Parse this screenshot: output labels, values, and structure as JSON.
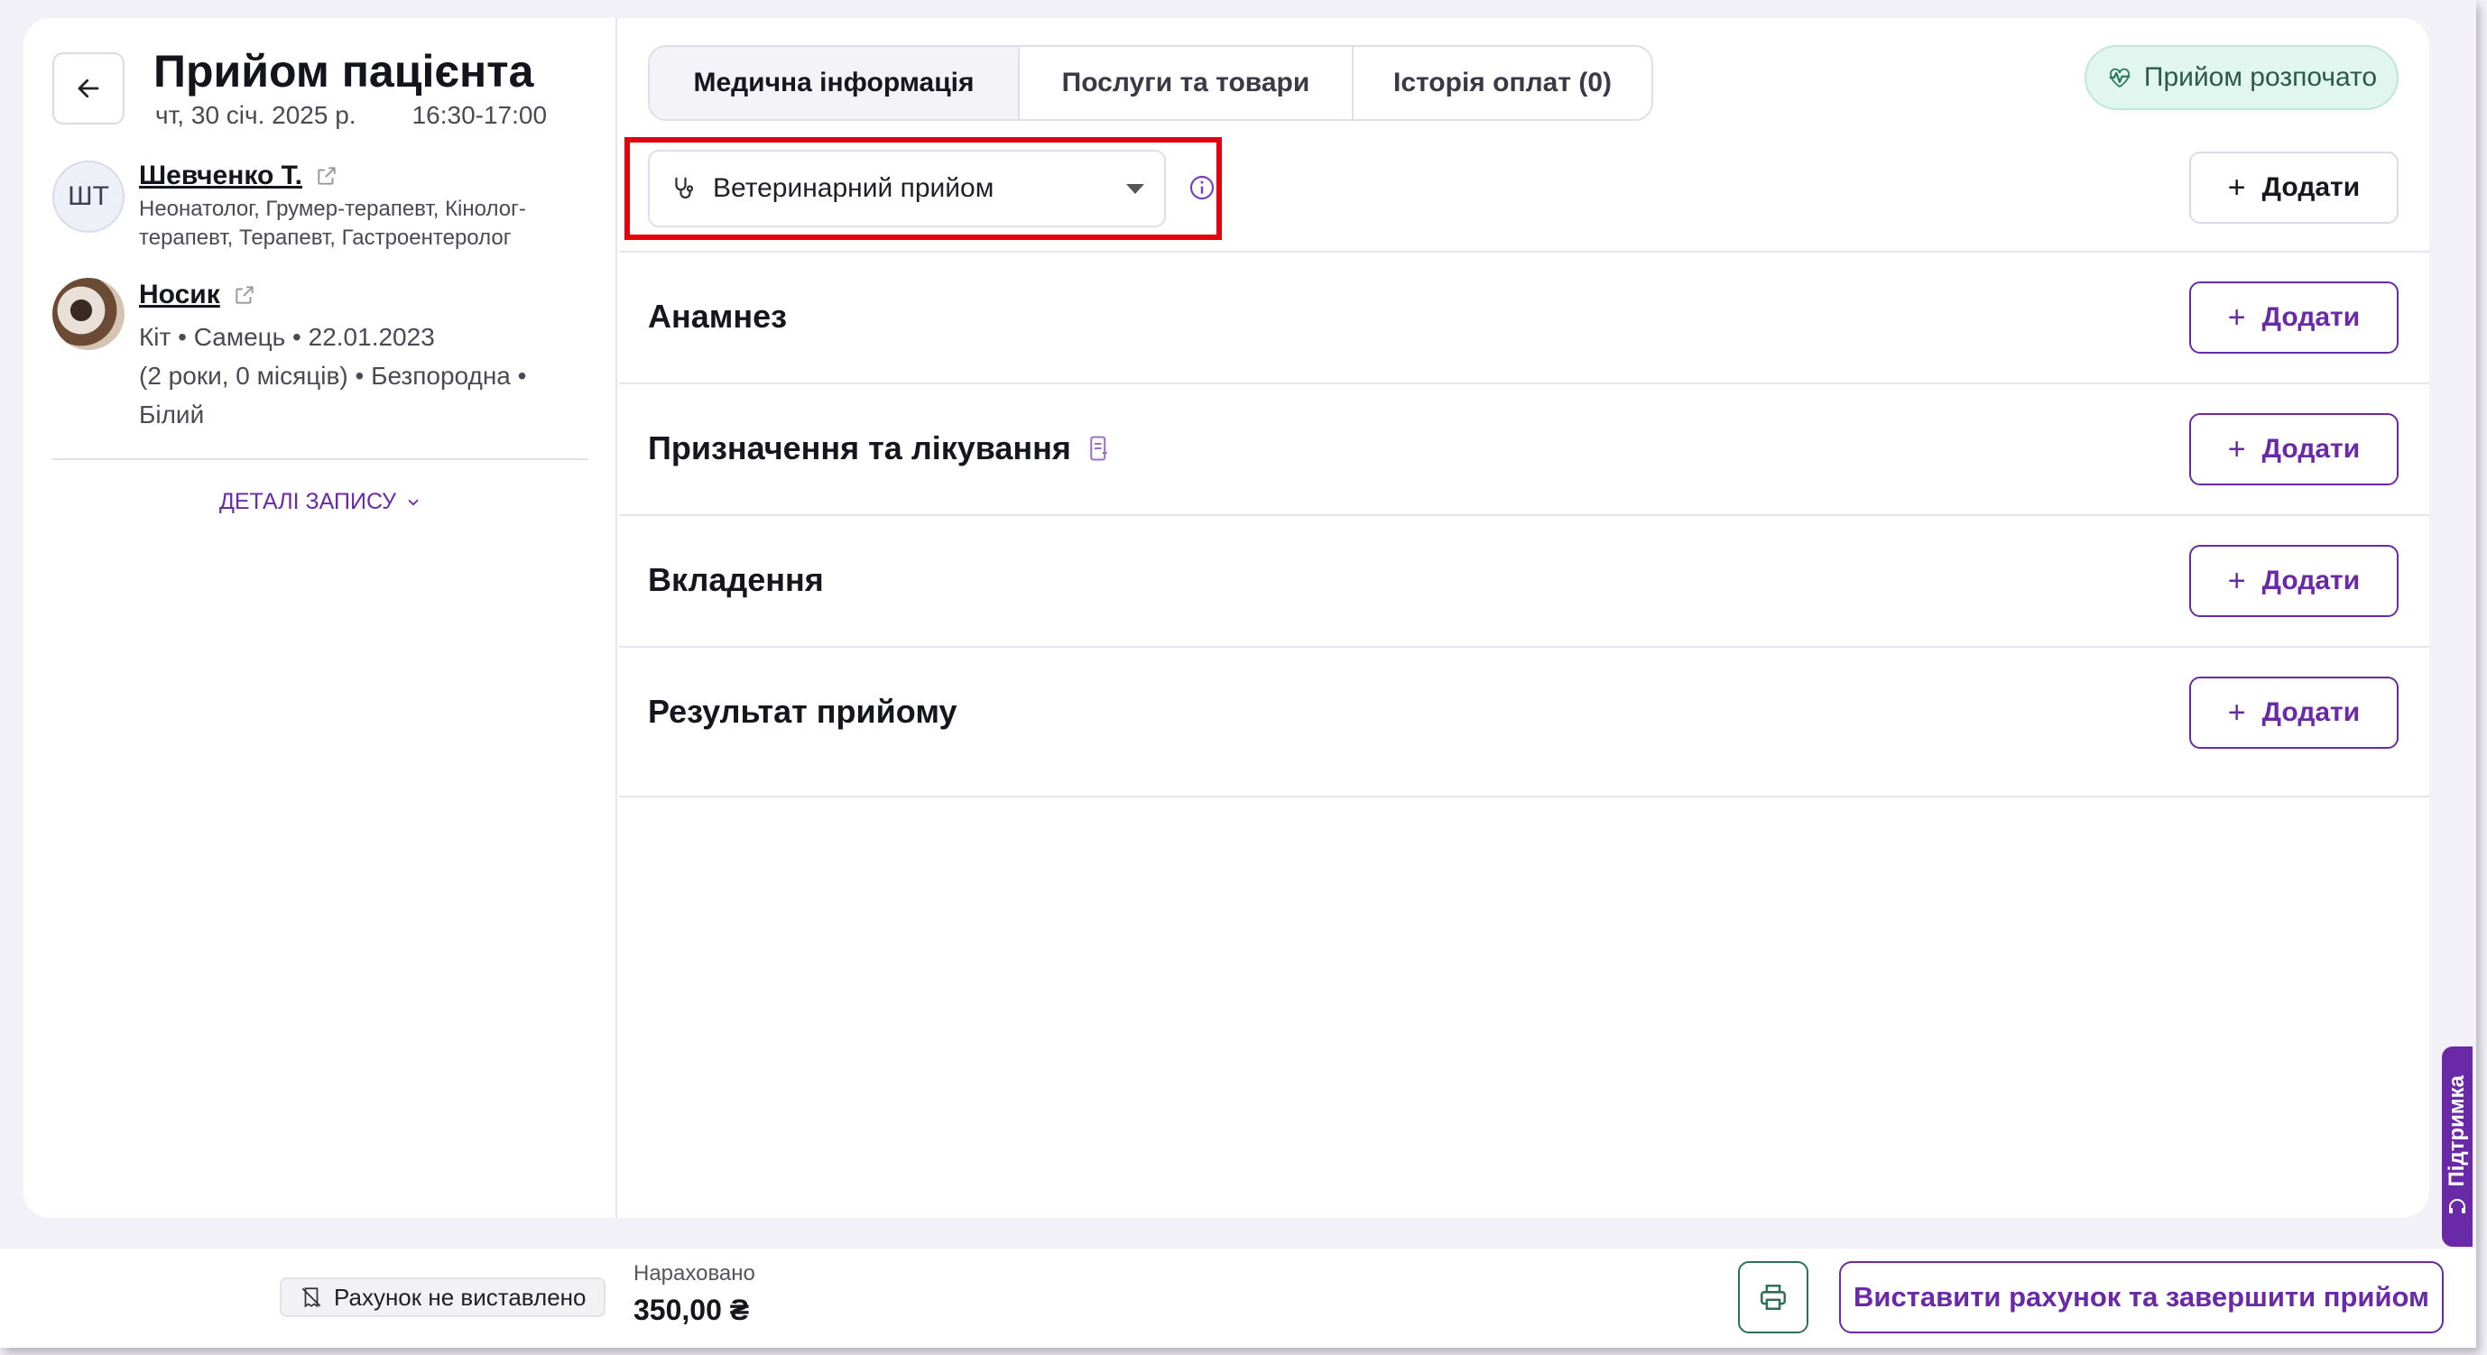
{
  "header": {
    "title": "Прийом пацієнта",
    "date": "чт, 30 січ. 2025 р.",
    "time": "16:30-17:00"
  },
  "doctor": {
    "initials": "ШТ",
    "name": "Шевченко Т.",
    "specialties": "Неонатолог, Грумер-терапевт, Кінолог-терапевт, Терапевт, Гастроентеролог"
  },
  "pet": {
    "name": "Носик",
    "line1": "Кіт • Самець • 22.01.2023",
    "line2": "(2 роки, 0 місяців) • Безпородна •",
    "line3": "Білий"
  },
  "details_link": "ДЕТАЛІ ЗАПИСУ",
  "tabs": [
    {
      "label": "Медична інформація"
    },
    {
      "label": "Послуги та товари"
    },
    {
      "label": "Історія оплат (0)"
    }
  ],
  "status": "Прийом розпочато",
  "visit_type": {
    "selected": "Ветеринарний прийом"
  },
  "add_label": "Додати",
  "sections": [
    {
      "title": "Анамнез"
    },
    {
      "title": "Призначення та лікування"
    },
    {
      "title": "Вкладення"
    },
    {
      "title": "Результат прийому"
    }
  ],
  "support_label": "Підтримка",
  "footer": {
    "invoice_status": "Рахунок не виставлено",
    "accrued_label": "Нараховано",
    "accrued_value": "350,00 ₴",
    "finish_label": "Виставити рахунок та завершити прийом"
  },
  "colors": {
    "accent": "#6a2aa8",
    "status_bg": "#e1f6ee",
    "highlight": "#e3000b"
  }
}
